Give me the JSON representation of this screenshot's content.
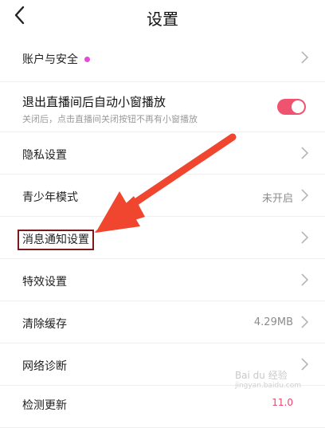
{
  "header": {
    "title": "设置"
  },
  "rows": [
    {
      "label": "账户与安全",
      "has_dot": true,
      "dot_color": "#e64bd6"
    },
    {
      "label": "退出直播间后自动小窗播放",
      "sublabel": "关闭后，点击直播间关闭按钮不再有小窗播放",
      "toggle_on": true,
      "toggle_color": "#f0536f"
    },
    {
      "label": "隐私设置"
    },
    {
      "label": "青少年模式",
      "value": "未开启"
    },
    {
      "label": "消息通知设置"
    },
    {
      "label": "特效设置"
    },
    {
      "label": "清除缓存",
      "value": "4.29MB"
    },
    {
      "label": "网络诊断"
    },
    {
      "label": "检测更新",
      "value": "11.0"
    }
  ],
  "annotation": {
    "arrow_color": "#f0462f",
    "box_color": "#7a1a1a"
  },
  "watermark": {
    "text": "Bai du 经验",
    "sub": "jingyan.baidu.com"
  }
}
